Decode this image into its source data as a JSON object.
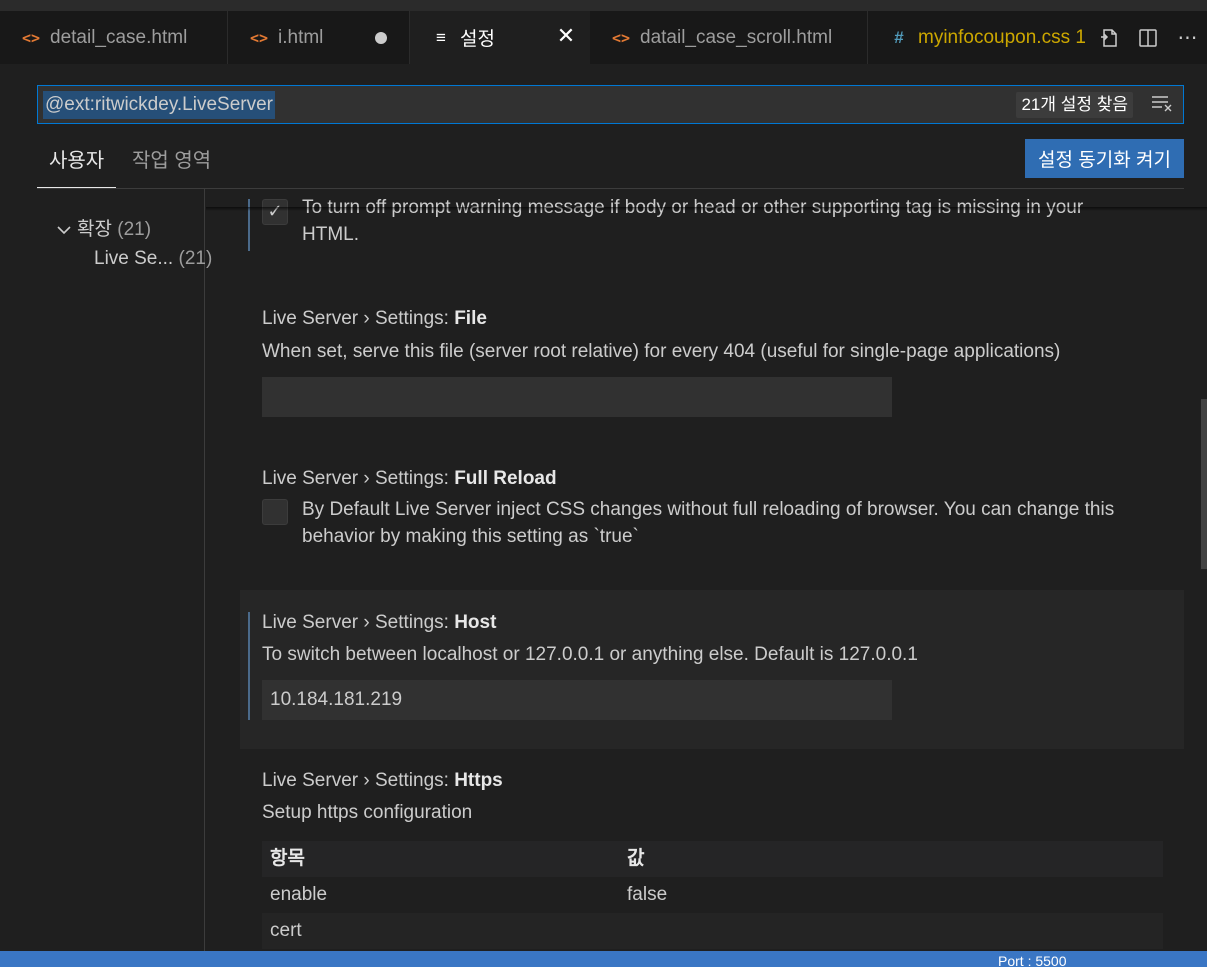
{
  "tabs": [
    {
      "label": "detail_case.html",
      "icon": "<>"
    },
    {
      "label": "i.html",
      "icon": "<>"
    },
    {
      "label": "설정",
      "icon": "≡"
    },
    {
      "label": "datail_case_scroll.html",
      "icon": "<>"
    },
    {
      "label": "myinfocoupon.css 1",
      "icon": "#"
    }
  ],
  "search": {
    "value": "@ext:ritwickdey.LiveServer",
    "result_count": "21개 설정 찾음"
  },
  "scopes": {
    "user": "사용자",
    "workspace": "작업 영역",
    "sync_button": "설정 동기화 켜기"
  },
  "toc": {
    "group_label": "확장",
    "group_count": "(21)",
    "item_label": "Live Se...",
    "item_count": "(21)"
  },
  "settings": {
    "partial": {
      "desc_line1": "To turn off prompt warning message if body or head or other supporting tag is missing in your",
      "desc_line2": "HTML."
    },
    "file": {
      "prefix": "Live Server › Settings: ",
      "name": "File",
      "description": "When set, serve this file (server root relative) for every 404 (useful for single-page applications)",
      "value": ""
    },
    "full_reload": {
      "prefix": "Live Server › Settings: ",
      "name": "Full Reload",
      "description_line1": "By Default Live Server inject CSS changes without full reloading of browser. You can change this",
      "description_line2": "behavior by making this setting as `true`",
      "checked": false
    },
    "host": {
      "prefix": "Live Server › Settings: ",
      "name": "Host",
      "description": "To switch between localhost or 127.0.0.1 or anything else. Default is 127.0.0.1",
      "value": "10.184.181.219"
    },
    "https": {
      "prefix": "Live Server › Settings: ",
      "name": "Https",
      "description": "Setup https configuration",
      "table_header": {
        "key": "항목",
        "value": "값"
      },
      "rows": [
        {
          "key": "enable",
          "value": "false"
        },
        {
          "key": "cert",
          "value": ""
        }
      ]
    }
  },
  "statusbar": {
    "port_text": "Port : 5500"
  },
  "colors": {
    "accent": "#0078d4",
    "button": "#2f6db3",
    "statusbar": "#3a76c4",
    "html_icon": "#e37933",
    "css_icon": "#519aba"
  }
}
